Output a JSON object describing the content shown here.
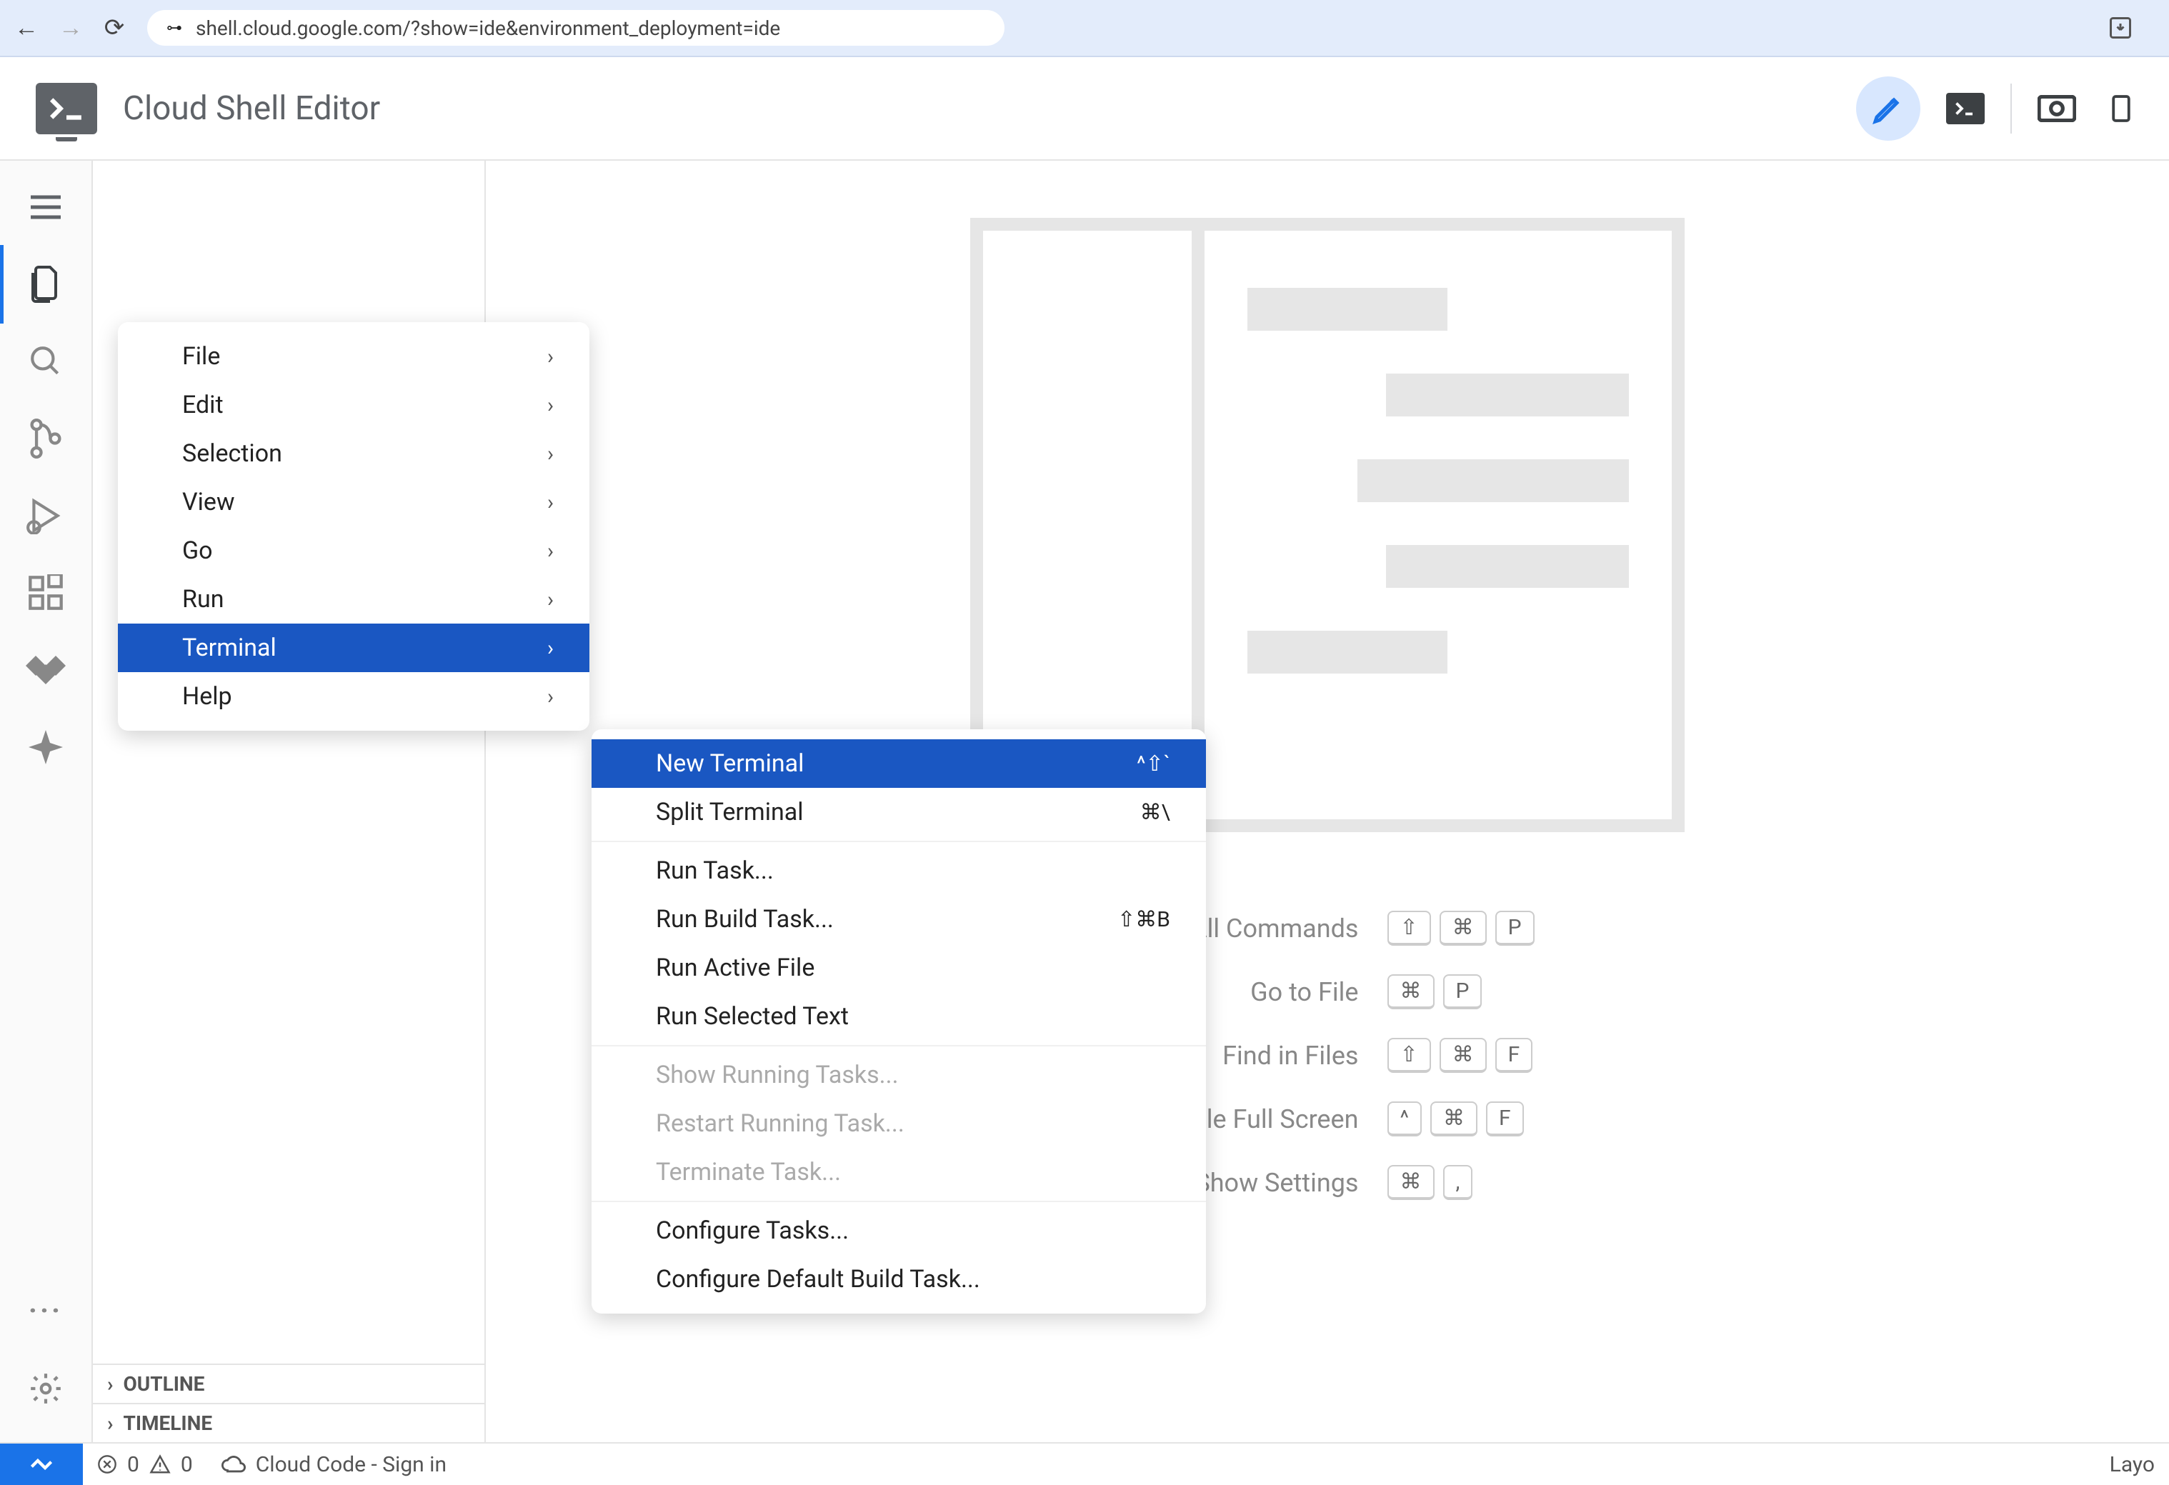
{
  "browser": {
    "url": "shell.cloud.google.com/?show=ide&environment_deployment=ide"
  },
  "header": {
    "title": "Cloud Shell Editor"
  },
  "mainMenu": {
    "items": [
      "File",
      "Edit",
      "Selection",
      "View",
      "Go",
      "Run",
      "Terminal",
      "Help"
    ]
  },
  "terminalMenu": {
    "items": [
      {
        "label": "New Terminal",
        "shortcut": "^⇧`",
        "highlight": true
      },
      {
        "label": "Split Terminal",
        "shortcut": "⌘\\"
      }
    ],
    "group2": [
      {
        "label": "Run Task..."
      },
      {
        "label": "Run Build Task...",
        "shortcut": "⇧⌘B"
      },
      {
        "label": "Run Active File"
      },
      {
        "label": "Run Selected Text"
      }
    ],
    "group3": [
      {
        "label": "Show Running Tasks...",
        "disabled": true
      },
      {
        "label": "Restart Running Task...",
        "disabled": true
      },
      {
        "label": "Terminate Task...",
        "disabled": true
      }
    ],
    "group4": [
      {
        "label": "Configure Tasks..."
      },
      {
        "label": "Configure Default Build Task..."
      }
    ]
  },
  "welcome": {
    "rows": [
      {
        "label": "Show All Commands",
        "keys": [
          "⇧",
          "⌘",
          "P"
        ]
      },
      {
        "label": "Go to File",
        "keys": [
          "⌘",
          "P"
        ]
      },
      {
        "label": "Find in Files",
        "keys": [
          "⇧",
          "⌘",
          "F"
        ]
      },
      {
        "label": "Toggle Full Screen",
        "keys": [
          "^",
          "⌘",
          "F"
        ]
      },
      {
        "label": "Show Settings",
        "keys": [
          "⌘",
          ","
        ]
      }
    ]
  },
  "sidepanel": {
    "outline": "OUTLINE",
    "timeline": "TIMELINE"
  },
  "status": {
    "errors": "0",
    "warnings": "0",
    "cloudCode": "Cloud Code - Sign in",
    "layout": "Layo"
  }
}
